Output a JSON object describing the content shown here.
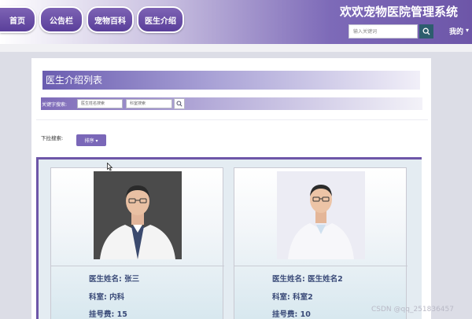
{
  "header": {
    "nav": [
      "首页",
      "公告栏",
      "宠物百科",
      "医生介绍"
    ],
    "site_title": "欢欢宠物医院管理系统",
    "search_placeholder": "输入关键词",
    "user_menu": "我的",
    "user_menu_arrow": "▾"
  },
  "main": {
    "list_title": "医生介绍列表",
    "keyword_label": "关键字搜索:",
    "name_placeholder": "医生姓名搜索",
    "dept_placeholder": "科室搜索",
    "dropdown_label": "下拉搜索:",
    "sort_label": "排序 ▾"
  },
  "cards": [
    {
      "name": "医生姓名: 张三",
      "dept": "科室: 内科",
      "third": "挂号费: 15"
    },
    {
      "name": "医生姓名: 医生姓名2",
      "dept": "科室: 科室2",
      "third": "挂号费: 10"
    }
  ],
  "watermark": "CSDN @qq_251836457",
  "colors": {
    "accent": "#6d56a8",
    "nav_button": "#5a3f9a",
    "search_button": "#2d5d6e",
    "card_text": "#3a4a78"
  },
  "icons": {
    "search": "search-icon",
    "cursor": "mouse-cursor-icon"
  }
}
